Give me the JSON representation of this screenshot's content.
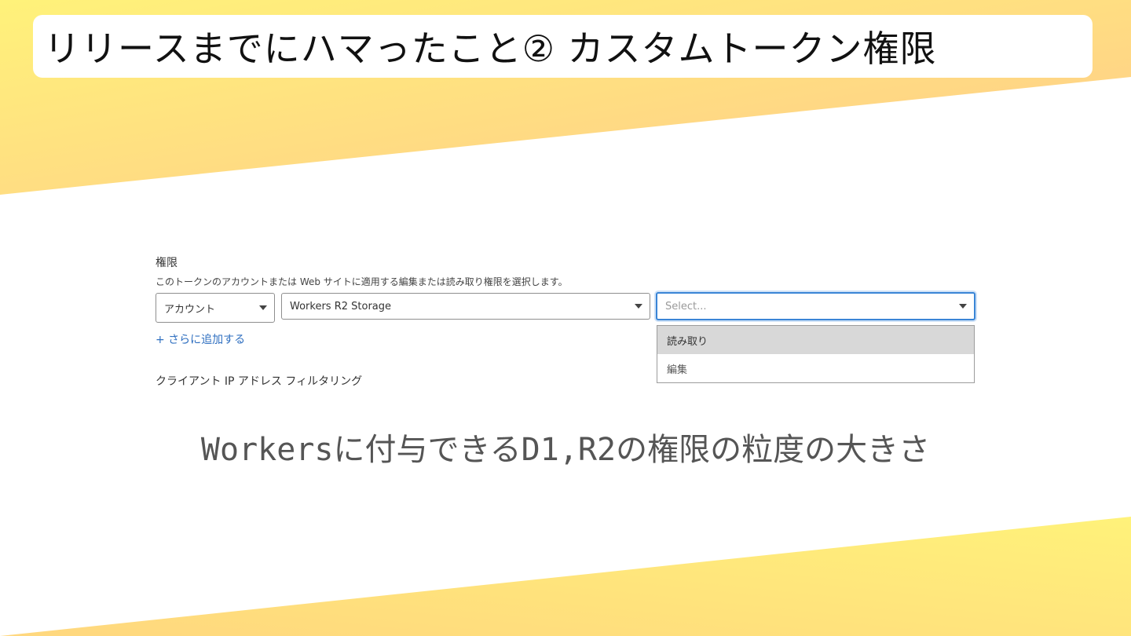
{
  "slide": {
    "title": "リリースまでにハマったこと② カスタムトークン権限",
    "caption": "Workersに付与できるD1,R2の権限の粒度の大きさ"
  },
  "colors": {
    "gradient_top_from": "#fff27a",
    "gradient_top_to": "#ffc98a",
    "accent_blue": "#3a85d6",
    "link_blue": "#2f6fc0"
  },
  "form": {
    "section_label": "権限",
    "description": "このトークンのアカウントまたは Web サイトに適用する編集または読み取り権限を選択します。",
    "scope_select": {
      "value": "アカウント"
    },
    "resource_select": {
      "value": "Workers R2 Storage"
    },
    "permission_select": {
      "placeholder": "Select...",
      "options": [
        "読み取り",
        "編集"
      ]
    },
    "add_more_label": "+ さらに追加する",
    "ip_filter_label": "クライアント IP アドレス フィルタリング"
  }
}
